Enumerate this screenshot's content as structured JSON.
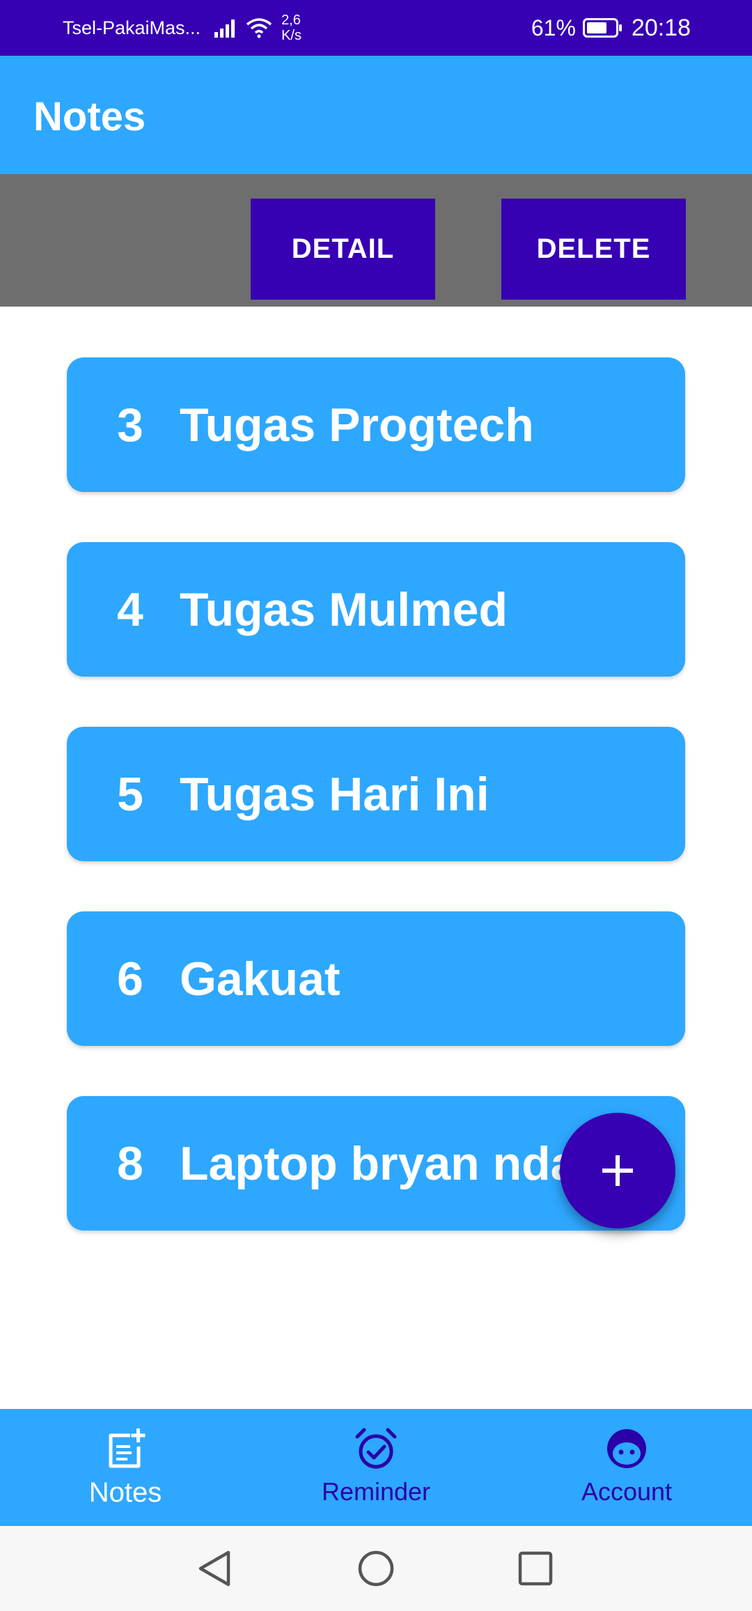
{
  "status_bar": {
    "carrier": "Tsel-PakaiMas...",
    "net_speed_value": "2,6",
    "net_speed_unit": "K/s",
    "battery": "61%",
    "time": "20:18",
    "icons": [
      "signal-icon",
      "wifi-icon",
      "battery-icon"
    ]
  },
  "app_bar": {
    "title": "Notes"
  },
  "actions": {
    "detail_label": "DETAIL",
    "delete_label": "DELETE"
  },
  "notes": [
    {
      "id": "3",
      "title": "Tugas Progtech"
    },
    {
      "id": "4",
      "title": "Tugas Mulmed"
    },
    {
      "id": "5",
      "title": "Tugas Hari Ini"
    },
    {
      "id": "6",
      "title": "Gakuat"
    },
    {
      "id": "8",
      "title": "Laptop bryan ndak"
    }
  ],
  "fab": {
    "icon": "plus-icon"
  },
  "bottom_nav": {
    "items": [
      {
        "label": "Notes",
        "icon": "note-add-icon",
        "active": true
      },
      {
        "label": "Reminder",
        "icon": "alarm-check-icon",
        "active": false
      },
      {
        "label": "Account",
        "icon": "face-icon",
        "active": false
      }
    ]
  },
  "system_nav": {
    "icons": [
      "back-icon",
      "home-icon",
      "recents-icon"
    ]
  },
  "colors": {
    "primary_dark": "#3700b3",
    "primary": "#2ea7ff",
    "action_bar_bg": "#6e6e6e",
    "nav_inactive": "#2a00a8"
  }
}
